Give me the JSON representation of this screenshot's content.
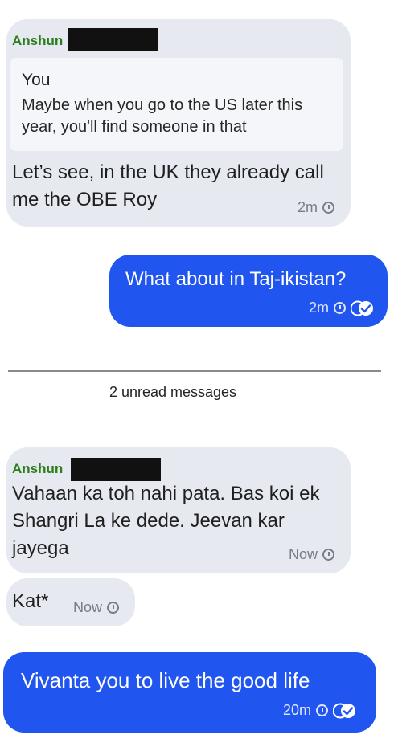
{
  "messages": [
    {
      "sender": "Anshun",
      "quote": {
        "name": "You",
        "text": "Maybe when you go to the US later this year, you'll find someone in that"
      },
      "text": "Let’s see, in the UK they already call me the OBE Roy",
      "time": "2m"
    },
    {
      "text": "What about in Taj-ikistan?",
      "time": "2m"
    },
    {
      "sender": "Anshun",
      "text": "Vahaan ka toh nahi pata. Bas koi ek Shangri La ke dede. Jeevan kar jayega",
      "time": "Now"
    },
    {
      "text": "Kat*",
      "time": "Now"
    },
    {
      "text": "Vivanta you to live the good life",
      "time": "20m"
    }
  ],
  "divider": {
    "label": "2 unread messages"
  },
  "colors": {
    "incoming_bubble": "#e6e9f0",
    "outgoing_bubble": "#2155f0",
    "sender_name": "#2e7d1c"
  }
}
